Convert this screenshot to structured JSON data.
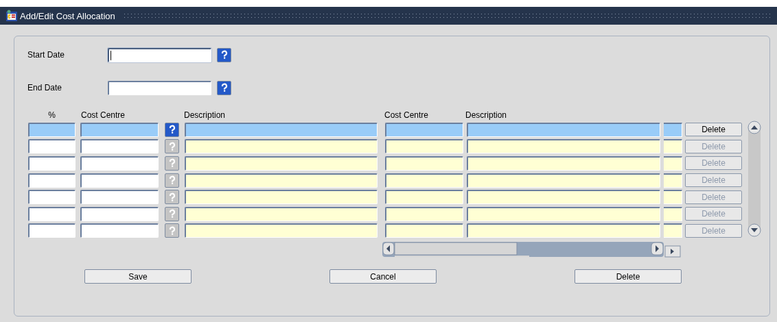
{
  "window": {
    "title": "Add/Edit Cost Allocation"
  },
  "date_fields": [
    {
      "label": "Start Date",
      "focused": true
    },
    {
      "label": "End Date",
      "focused": false
    }
  ],
  "table": {
    "columns": [
      "%",
      "Cost Centre",
      "Description",
      "Cost Centre",
      "Description"
    ],
    "rows": [
      {
        "selected": true,
        "delete": "Delete"
      },
      {
        "selected": false,
        "delete": "Delete"
      },
      {
        "selected": false,
        "delete": "Delete"
      },
      {
        "selected": false,
        "delete": "Delete"
      },
      {
        "selected": false,
        "delete": "Delete"
      },
      {
        "selected": false,
        "delete": "Delete"
      },
      {
        "selected": false,
        "delete": "Delete"
      }
    ]
  },
  "buttons": [
    "Save",
    "Cancel",
    "Delete"
  ]
}
